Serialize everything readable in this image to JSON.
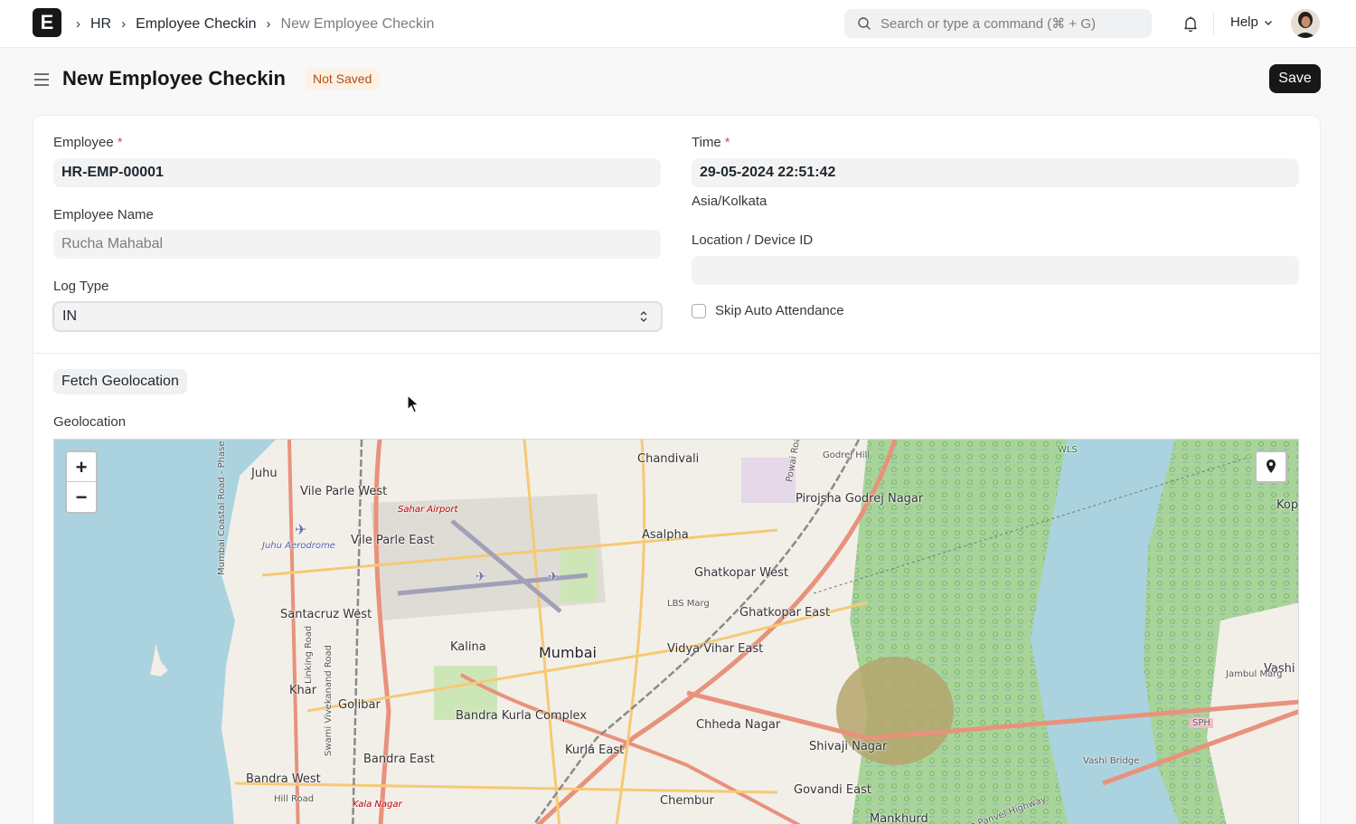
{
  "navbar": {
    "logo_letter": "E",
    "breadcrumbs": [
      "HR",
      "Employee Checkin",
      "New Employee Checkin"
    ],
    "search_placeholder": "Search or type a command (⌘ + G)",
    "help_label": "Help"
  },
  "page": {
    "title": "New Employee Checkin",
    "status": "Not Saved",
    "save_label": "Save"
  },
  "form": {
    "employee_label": "Employee",
    "employee_value": "HR-EMP-00001",
    "employee_name_label": "Employee Name",
    "employee_name_value": "Rucha Mahabal",
    "log_type_label": "Log Type",
    "log_type_value": "IN",
    "time_label": "Time",
    "time_value": "29-05-2024 22:51:42",
    "timezone": "Asia/Kolkata",
    "location_label": "Location / Device ID",
    "location_value": "",
    "skip_label": "Skip Auto Attendance",
    "required_mark": "*",
    "fetch_geolocation_label": "Fetch Geolocation",
    "geolocation_label": "Geolocation"
  },
  "map": {
    "zoom_in": "+",
    "zoom_out": "−",
    "places": [
      "Juhu",
      "Vile Parle West",
      "Sahar Airport",
      "Juhu Aerodrome",
      "Vile Parle East",
      "Chandivali",
      "Powai Road",
      "Godrej Hill",
      "Pirojsha Godrej Nagar",
      "WLS",
      "Kop",
      "Asalpha",
      "Ghatkopar West",
      "LBS Marg",
      "Ghatkopar East",
      "Santacruz West",
      "Kalina",
      "Mumbai",
      "Vidya Vihar East",
      "Khar",
      "Golibar",
      "Bandra Kurla Complex",
      "Bandra East",
      "Bandra West",
      "Kurla East",
      "Chheda Nagar",
      "Shivaji Nagar",
      "Govandi East",
      "Chembur",
      "Mankhurd",
      "Vashi",
      "Jambul Marg",
      "SPH",
      "Vashi Bridge",
      "Kala Nagar",
      "Hill Road",
      "Sion Panvel Highway",
      "Mumbai Coastal Road - Phase II",
      "Linking Road",
      "Swami Vivekanand Road"
    ],
    "colors": {
      "water": "#aad3df",
      "land": "#f2efe9",
      "park": "#cde6b8",
      "mangrove": "#9fcf8a",
      "primary_road": "#e8927c",
      "secondary_road": "#f7c974",
      "rail": "#8a8a8a"
    }
  }
}
